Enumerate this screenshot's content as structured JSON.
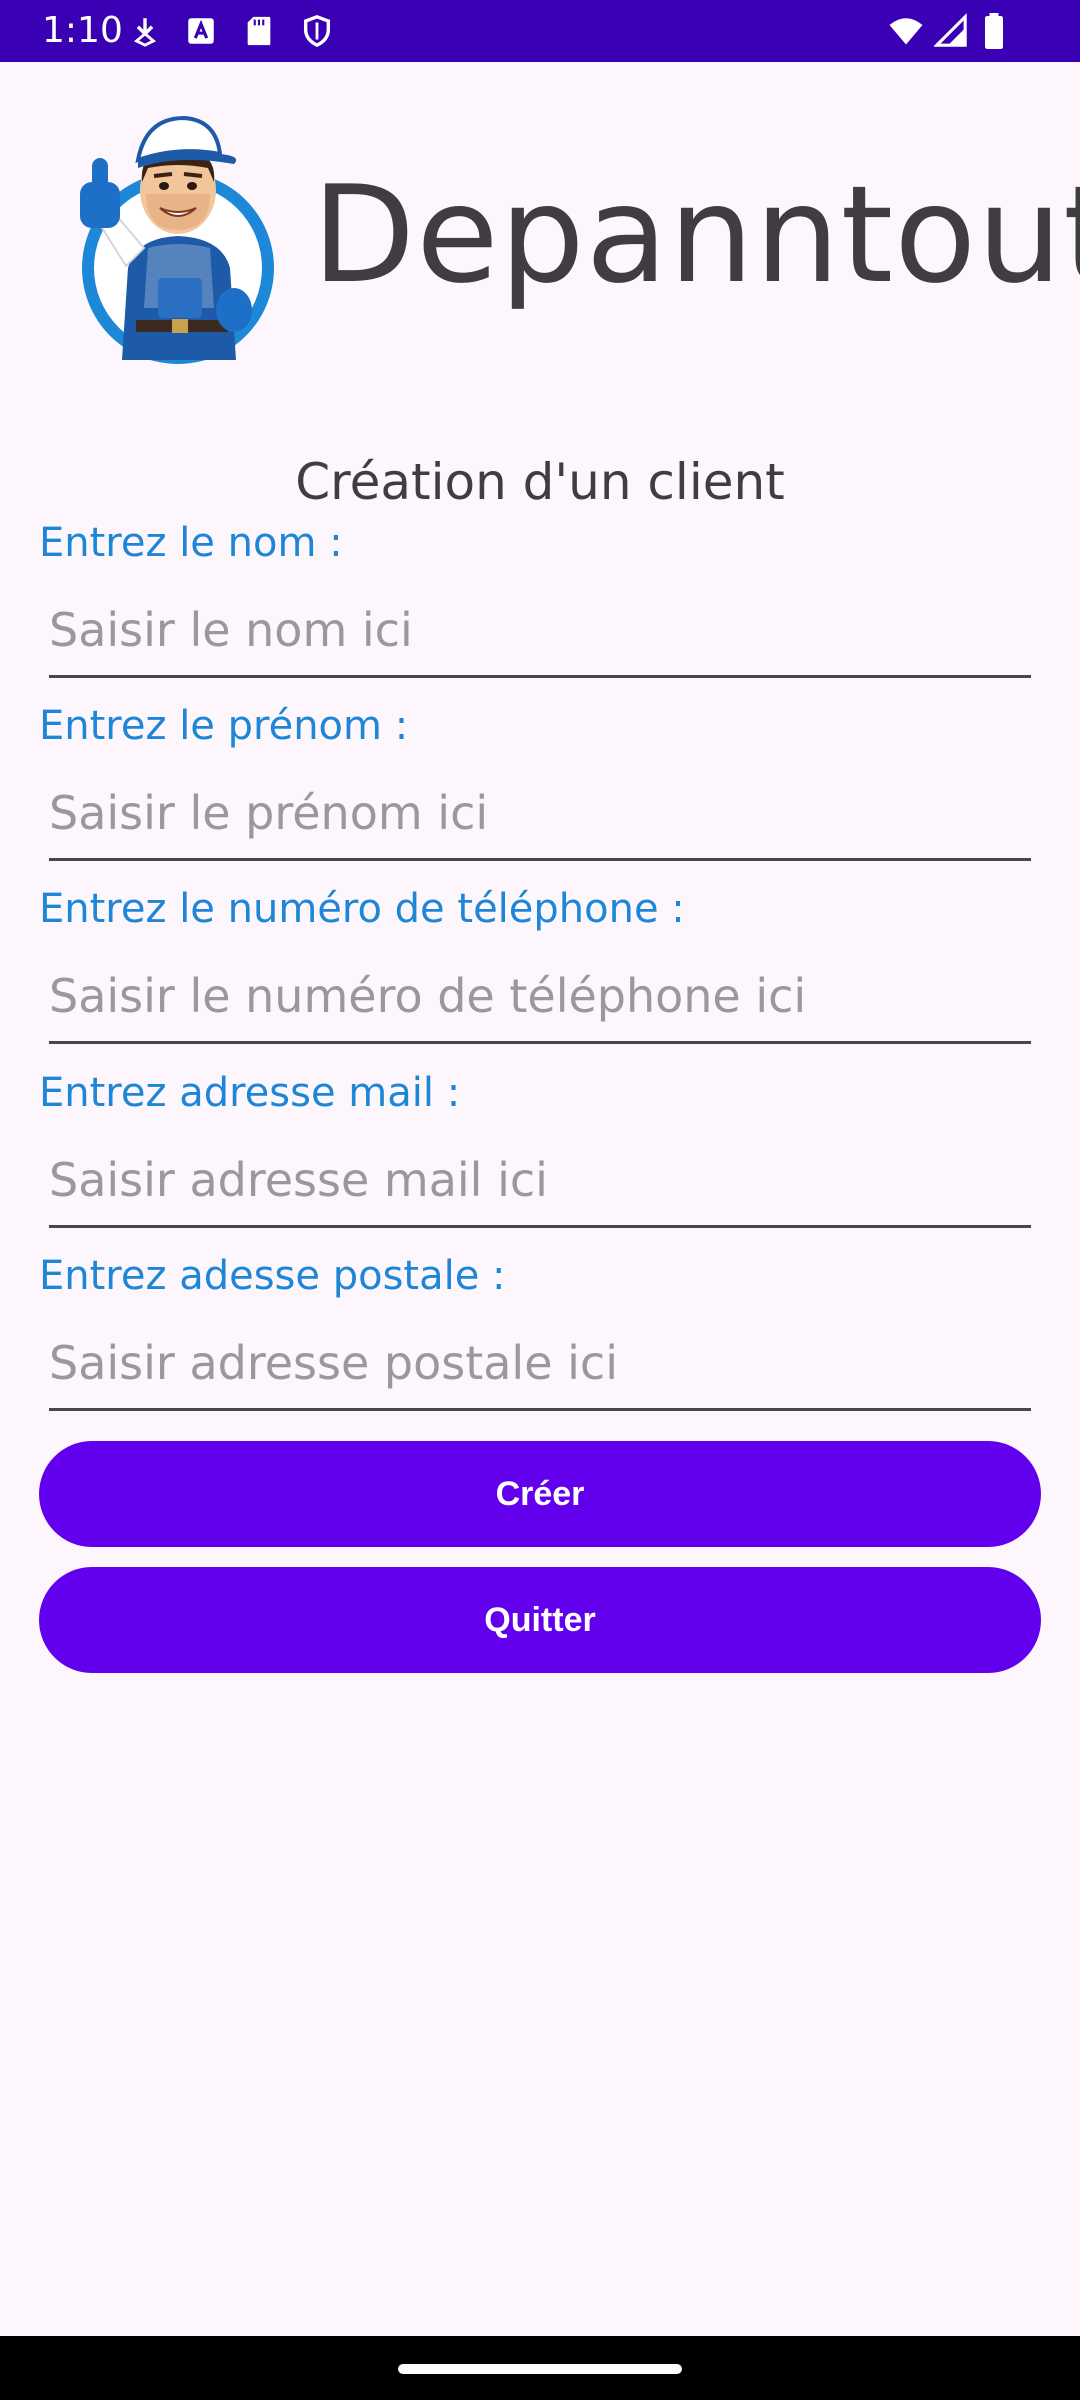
{
  "status_bar": {
    "time": "1:10",
    "icons": [
      "download-arrow-icon",
      "text-a-icon",
      "sd-card-icon",
      "shield-icon",
      "wifi-icon",
      "signal-icon",
      "battery-icon"
    ],
    "background": "#3a00b4"
  },
  "header": {
    "app_title": "Depanntout",
    "logo": "repairman-mascot-logo"
  },
  "form": {
    "title": "Création d'un client",
    "fields": [
      {
        "label": "Entrez le nom :",
        "placeholder": "Saisir le nom ici",
        "value": ""
      },
      {
        "label": "Entrez le prénom :",
        "placeholder": "Saisir le prénom ici",
        "value": ""
      },
      {
        "label": "Entrez le numéro de téléphone :",
        "placeholder": "Saisir le numéro de téléphone ici",
        "value": ""
      },
      {
        "label": "Entrez adresse mail :",
        "placeholder": "Saisir adresse mail ici",
        "value": ""
      },
      {
        "label": "Entrez adesse postale :",
        "placeholder": "Saisir adresse postale ici",
        "value": ""
      }
    ],
    "label_color": "#1e86d6"
  },
  "buttons": {
    "create_label": "Créer",
    "quit_label": "Quitter",
    "color": "#6200ee"
  }
}
